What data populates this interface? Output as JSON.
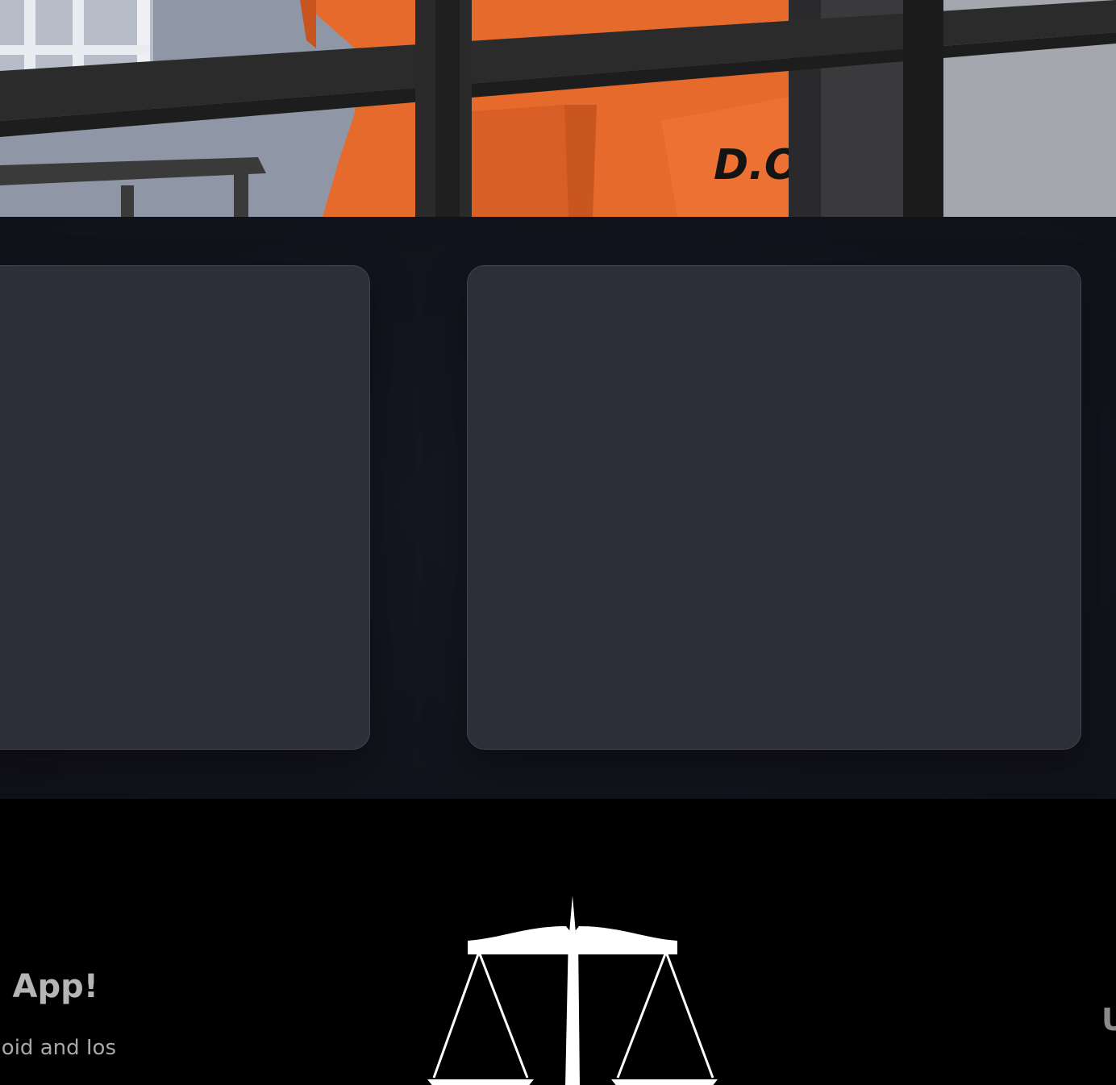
{
  "hero": {
    "image_subject": "inmate in orange jumpsuit behind jail bars",
    "jumpsuit_text": "D.O.C",
    "colors": {
      "wall": "#8f97a6",
      "jumpsuit": "#e8672a",
      "bars": "#2b2b2b"
    }
  },
  "cards": [
    {
      "id": "left-card"
    },
    {
      "id": "right-card"
    }
  ],
  "footer": {
    "app_title": "App!",
    "app_subtitle": "oid and Ios",
    "right_text": "U",
    "logo_icon": "scales-of-justice-icon"
  },
  "colors": {
    "section_bg": "#14141f",
    "card_bg": "#2e2e38",
    "footer_bg": "#000000",
    "footer_text": "#b5b5b5"
  }
}
